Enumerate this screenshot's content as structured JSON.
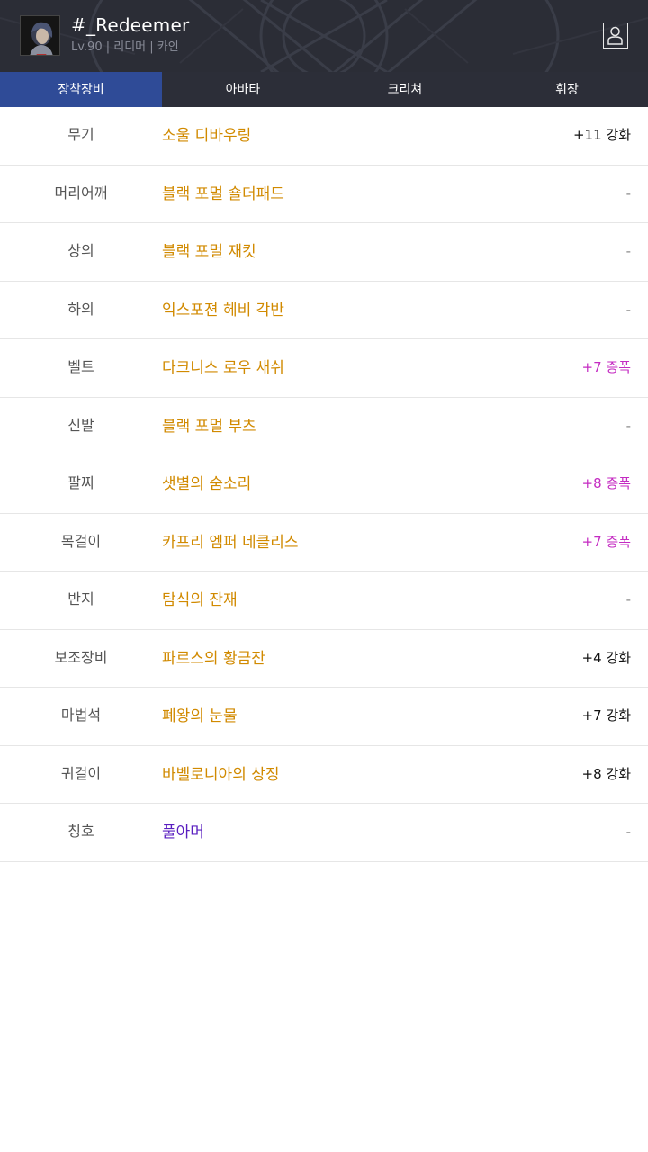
{
  "header": {
    "character_name": "#_Redeemer",
    "character_info": "Lv.90 | 리디머 | 카인",
    "profile_icon": "person-icon"
  },
  "tabs": [
    {
      "label": "장착장비",
      "active": true
    },
    {
      "label": "아바타",
      "active": false
    },
    {
      "label": "크리쳐",
      "active": false
    },
    {
      "label": "휘장",
      "active": false
    }
  ],
  "colors": {
    "header_bg": "#2b2d36",
    "active_tab": "#2f4b97",
    "item_name": "#d18a00",
    "title_name": "#5a1fc0",
    "boost": "#c42bc2"
  },
  "equipment": [
    {
      "slot": "무기",
      "item": "소울 디바우링",
      "enhance": "+11 강화"
    },
    {
      "slot": "머리어깨",
      "item": "블랙 포멀 숄더패드",
      "enhance": "-"
    },
    {
      "slot": "상의",
      "item": "블랙 포멀 재킷",
      "enhance": "-"
    },
    {
      "slot": "하의",
      "item": "익스포젼 헤비 각반",
      "enhance": "-"
    },
    {
      "slot": "벨트",
      "item": "다크니스 로우 새쉬",
      "enhance": "+7 증폭"
    },
    {
      "slot": "신발",
      "item": "블랙 포멀 부츠",
      "enhance": "-"
    },
    {
      "slot": "팔찌",
      "item": "샛별의 숨소리",
      "enhance": "+8 증폭"
    },
    {
      "slot": "목걸이",
      "item": "카프리 엠퍼 네클리스",
      "enhance": "+7 증폭"
    },
    {
      "slot": "반지",
      "item": "탐식의 잔재",
      "enhance": "-"
    },
    {
      "slot": "보조장비",
      "item": "파르스의 황금잔",
      "enhance": "+4 강화"
    },
    {
      "slot": "마법석",
      "item": "폐왕의 눈물",
      "enhance": "+7 강화"
    },
    {
      "slot": "귀걸이",
      "item": "바벨로니아의 상징",
      "enhance": "+8 강화"
    },
    {
      "slot": "칭호",
      "item": "풀아머",
      "enhance": "-"
    }
  ]
}
